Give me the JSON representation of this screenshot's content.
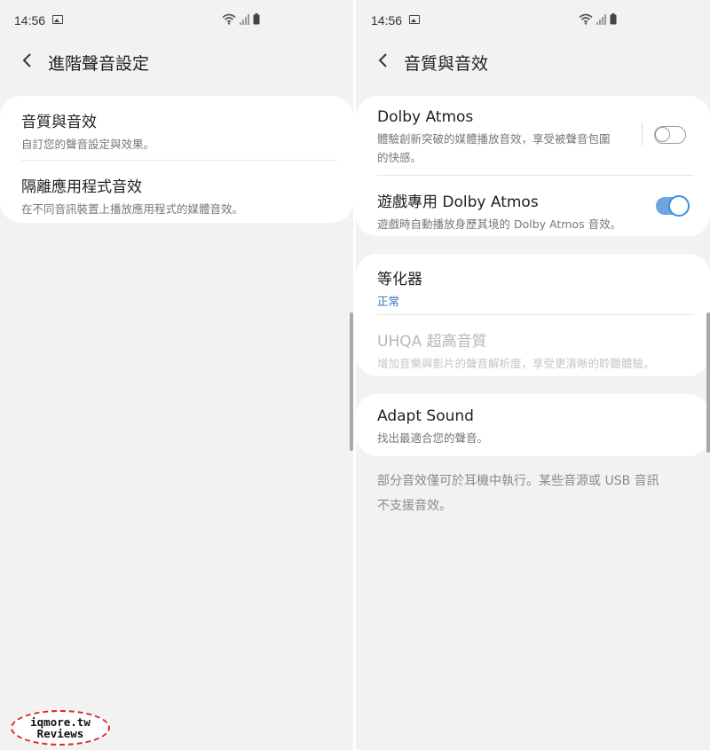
{
  "left": {
    "status": {
      "time": "14:56"
    },
    "title": "進階聲音設定",
    "items": [
      {
        "title": "音質與音效",
        "subtitle": "自訂您的聲音設定與效果。"
      },
      {
        "title": "隔離應用程式音效",
        "subtitle": "在不同音訊裝置上播放應用程式的媒體音效。"
      }
    ]
  },
  "right": {
    "status": {
      "time": "14:56"
    },
    "title": "音質與音效",
    "dolby": {
      "title": "Dolby Atmos",
      "subtitle_1": "體驗創新突破的媒體播放音效，享受被聲音包圍",
      "subtitle_2": "的快感。",
      "enabled": false
    },
    "game_dolby": {
      "title": "遊戲專用 Dolby Atmos",
      "subtitle": "遊戲時自動播放身歷其境的 Dolby Atmos 音效。",
      "enabled": true
    },
    "equalizer": {
      "title": "等化器",
      "value": "正常"
    },
    "uhqa": {
      "title": "UHQA 超高音質",
      "subtitle": "增加音樂與影片的聲音解析度，享受更清晰的聆聽體驗。"
    },
    "adapt_sound": {
      "title": "Adapt Sound",
      "subtitle": "找出最適合您的聲音。"
    },
    "footnote_1": "部分音效僅可於耳機中執行。某些音源或 USB 音訊",
    "footnote_2": "不支援音效。"
  },
  "watermark": {
    "line1": "iqmore.tw",
    "line2": "Reviews"
  },
  "colors": {
    "accent": "#3d8ee6",
    "background": "#f2f2f2",
    "card": "#ffffff",
    "watermark_red": "#e2222a"
  }
}
